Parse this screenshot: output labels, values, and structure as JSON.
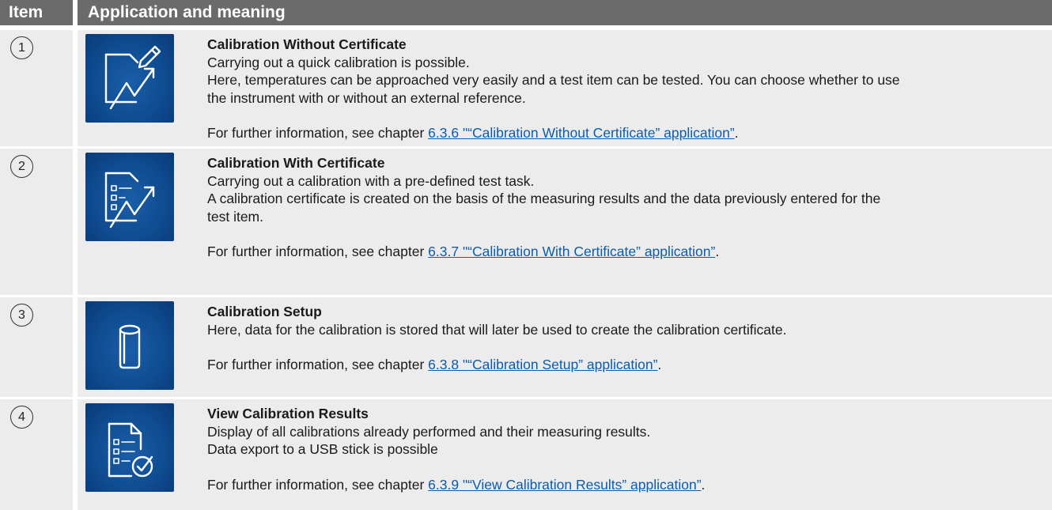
{
  "header": {
    "item": "Item",
    "application": "Application and meaning"
  },
  "rows": [
    {
      "number": "1",
      "icon": "calibration-without-certificate-icon",
      "title": "Calibration Without Certificate",
      "lines": [
        "Carrying out a quick calibration is possible.",
        "Here, temperatures can be approached very easily and a test item can be tested. You can choose whether to use",
        "the instrument with or without an external reference."
      ],
      "ref_prefix": "For further information, see chapter ",
      "ref_link": "6.3.6 \"“Calibration Without Certificate” application”",
      "ref_suffix": "."
    },
    {
      "number": "2",
      "icon": "calibration-with-certificate-icon",
      "title": "Calibration With Certificate",
      "lines": [
        "Carrying out a calibration with a pre-defined test task.",
        "A calibration certificate is created on the basis of the measuring results and the data previously entered for the",
        "test item."
      ],
      "ref_prefix": "For further information, see chapter ",
      "ref_link": "6.3.7 \"“Calibration With Certificate” application”",
      "ref_suffix": "."
    },
    {
      "number": "3",
      "icon": "calibration-setup-icon",
      "title": "Calibration Setup",
      "lines": [
        "Here, data for the calibration is stored that will later be used to create the calibration certificate."
      ],
      "ref_prefix": "For further information, see chapter ",
      "ref_link": "6.3.8 \"“Calibration Setup” application”",
      "ref_suffix": "."
    },
    {
      "number": "4",
      "icon": "view-calibration-results-icon",
      "title": "View Calibration Results",
      "lines": [
        "Display of all calibrations already performed and their measuring results.",
        "Data export to a USB stick is possible"
      ],
      "ref_prefix": "For further information, see chapter ",
      "ref_link": "6.3.9 \"“View Calibration Results” application”",
      "ref_suffix": "."
    }
  ]
}
